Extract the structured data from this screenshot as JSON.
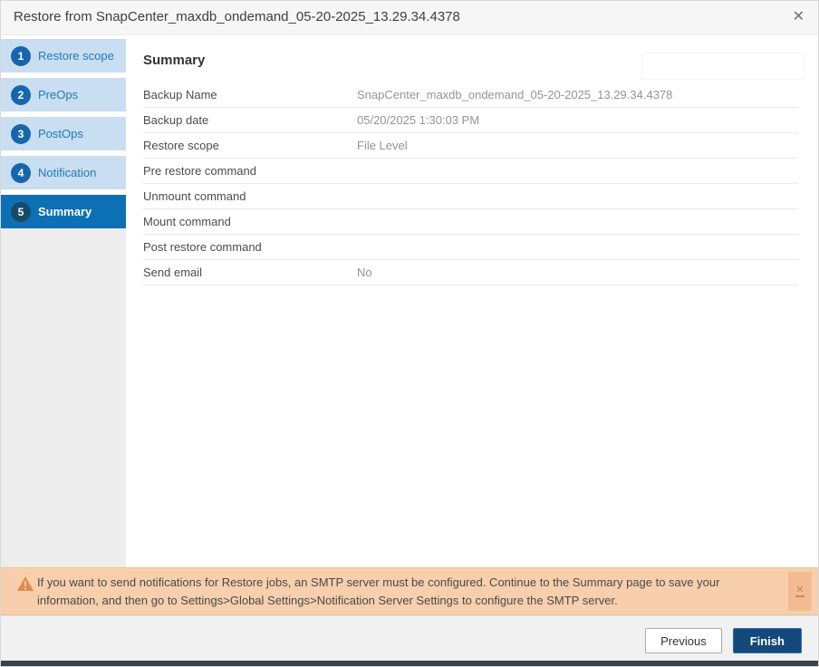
{
  "dialog": {
    "title": "Restore from SnapCenter_maxdb_ondemand_05-20-2025_13.29.34.4378",
    "close_glyph": "✕"
  },
  "steps": [
    {
      "num": "1",
      "label": "Restore scope",
      "active": false
    },
    {
      "num": "2",
      "label": "PreOps",
      "active": false
    },
    {
      "num": "3",
      "label": "PostOps",
      "active": false
    },
    {
      "num": "4",
      "label": "Notification",
      "active": false
    },
    {
      "num": "5",
      "label": "Summary",
      "active": true
    }
  ],
  "summary": {
    "heading": "Summary",
    "rows": [
      {
        "label": "Backup Name",
        "value": "SnapCenter_maxdb_ondemand_05-20-2025_13.29.34.4378"
      },
      {
        "label": "Backup date",
        "value": "05/20/2025 1:30:03 PM"
      },
      {
        "label": "Restore scope",
        "value": "File Level"
      },
      {
        "label": "Pre restore command",
        "value": ""
      },
      {
        "label": "Unmount command",
        "value": ""
      },
      {
        "label": "Mount command",
        "value": ""
      },
      {
        "label": "Post restore command",
        "value": ""
      },
      {
        "label": "Send email",
        "value": "No"
      }
    ]
  },
  "warning": {
    "icon": "warning-triangle-icon",
    "text": "If you want to send notifications for Restore jobs, an SMTP server must be configured. Continue to the Summary page to save your information, and then go to Settings>Global Settings>Notification Server Settings to configure the SMTP server.",
    "close_glyph": "✕"
  },
  "footer": {
    "previous_label": "Previous",
    "finish_label": "Finish"
  },
  "colors": {
    "active_step_bg": "#0E70B4",
    "inactive_step_bg": "#C9DEF0",
    "step_circle": "#1766AC",
    "active_step_circle": "#164A6B",
    "step_text": "#2279BE",
    "warning_bg": "#F7CFAC",
    "warning_border": "#EFC096",
    "finish_bg": "#15497B",
    "finish_border": "#2B71AE"
  }
}
